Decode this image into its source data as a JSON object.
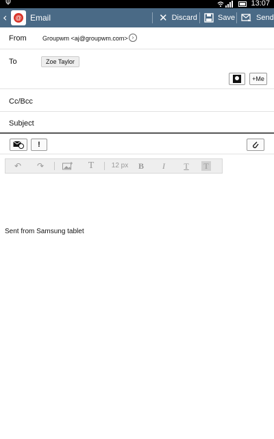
{
  "status_bar": {
    "time": "13:07",
    "usb_icon": "usb-icon",
    "wifi_icon": "wifi-icon",
    "signal_icon": "signal-icon",
    "battery_icon": "battery-icon"
  },
  "action_bar": {
    "title": "Email",
    "discard_label": "Discard",
    "save_label": "Save",
    "send_label": "Send",
    "colors": {
      "bar": "#4a6a86",
      "app_icon": "#d9362b"
    }
  },
  "from": {
    "label": "From",
    "value": "Groupwm <aj@groupwm.com>"
  },
  "to": {
    "label": "To",
    "recipient": "Zoe Taylor",
    "me_button": "+Me"
  },
  "cc": {
    "label": "Cc/Bcc"
  },
  "subject": {
    "label": "Subject"
  },
  "toolbar": {
    "priority_label": "!"
  },
  "format": {
    "font_size": "12 px",
    "bold": "B",
    "italic": "I",
    "underline": "T",
    "highlight": "T",
    "text_size": "T"
  },
  "body": {
    "signature": "Sent from Samsung tablet"
  }
}
